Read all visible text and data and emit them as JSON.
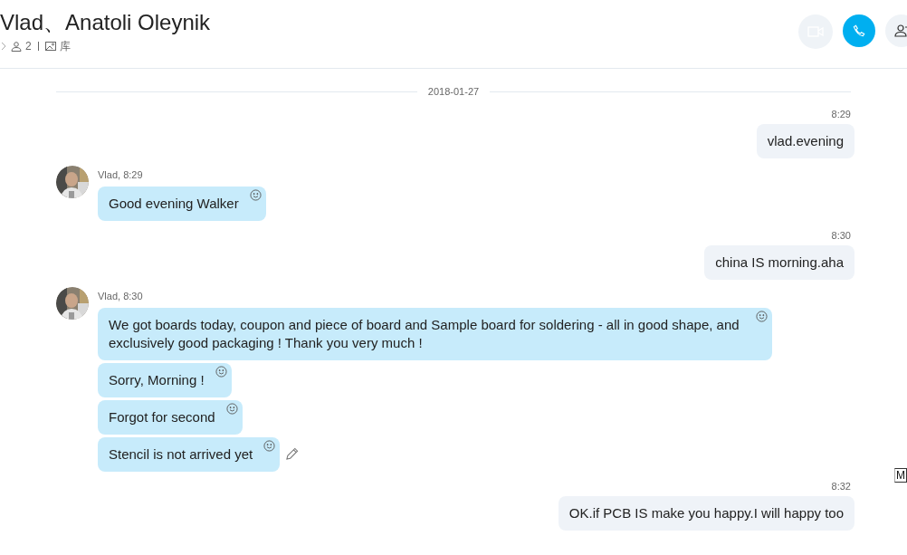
{
  "header": {
    "title": "Vlad、Anatoli Oleynik",
    "participants": "2",
    "gallery": "库"
  },
  "date_divider": "2018-01-27",
  "messages": [
    {
      "kind": "outgoing",
      "time": "8:29",
      "text": "vlad.evening"
    },
    {
      "kind": "incoming",
      "sender_time": "Vlad, 8:29",
      "bubbles": [
        {
          "text": "Good evening Walker",
          "edited": false
        }
      ]
    },
    {
      "kind": "outgoing",
      "time": "8:30",
      "text": "china IS morning.aha"
    },
    {
      "kind": "incoming",
      "sender_time": "Vlad, 8:30",
      "bubbles": [
        {
          "text": "We got boards today, coupon and piece of board and Sample board for soldering - all in good shape, and exclusively good packaging !  Thank you very much !",
          "edited": false
        },
        {
          "text": "Sorry, Morning !",
          "edited": false
        },
        {
          "text": "Forgot for second",
          "edited": false
        },
        {
          "text": "Stencil is not arrived yet",
          "edited": true
        }
      ]
    },
    {
      "kind": "outgoing",
      "time": "8:32",
      "text": "OK.if PCB IS make you happy.I will happy too"
    }
  ],
  "side_marker": "M"
}
